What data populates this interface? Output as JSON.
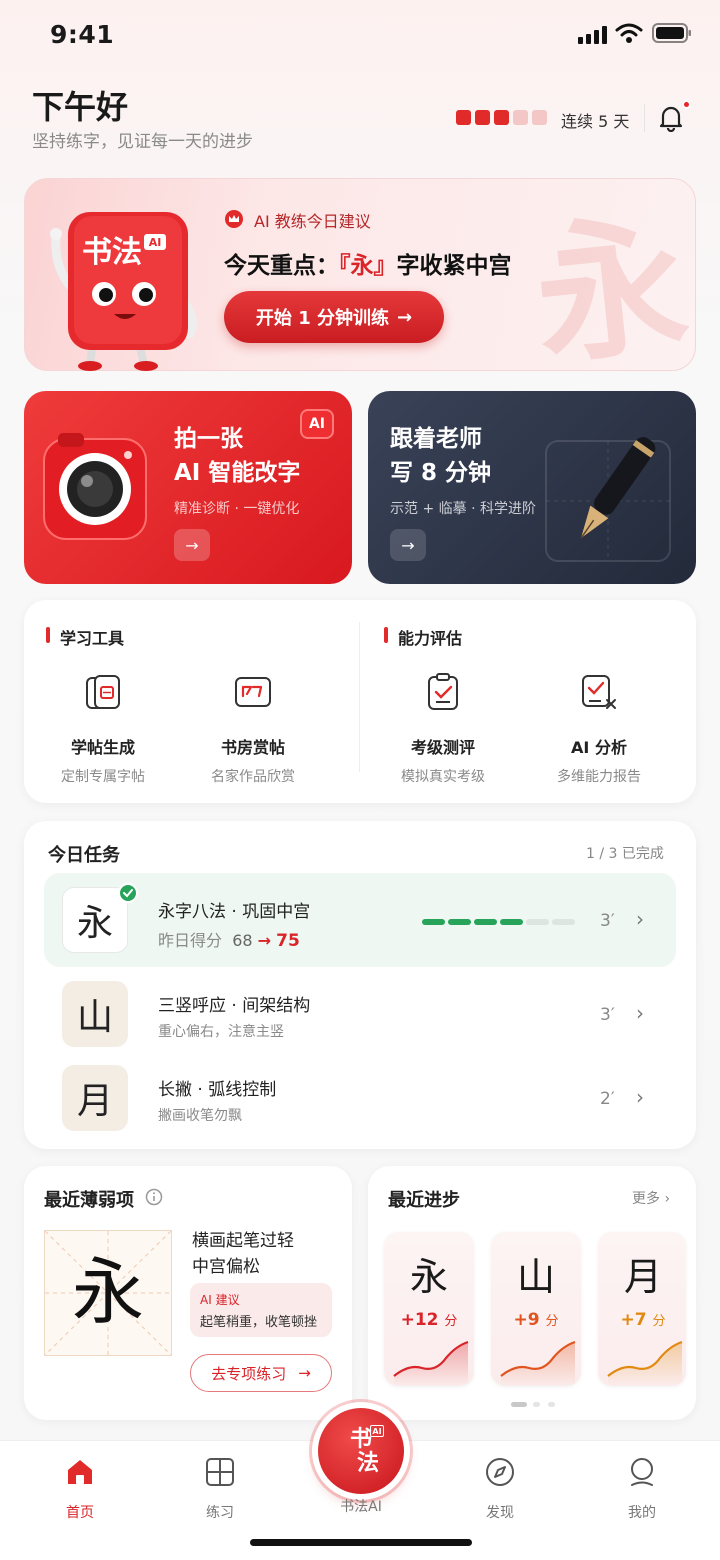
{
  "status": {
    "time": "9:41"
  },
  "header": {
    "greeting": "下午好",
    "subtitle": "坚持练字，见证每一天的进步",
    "streak_text": "连续 5 天",
    "streak_filled": 3,
    "streak_total": 5
  },
  "hero": {
    "tag": "AI 教练今日建议",
    "title_prefix": "今天重点：",
    "title_highlight": "『永』",
    "title_suffix": "字收紧中宫",
    "button": "开始 1 分钟训练",
    "bg_char": "永",
    "mascot_text": "书法",
    "mascot_badge": "AI"
  },
  "features": [
    {
      "title1": "拍一张",
      "title2": "AI 智能改字",
      "subtitle": "精准诊断 · 一键优化",
      "badge": "AI"
    },
    {
      "title1": "跟着老师",
      "title2": "写 8 分钟",
      "subtitle": "示范 + 临摹 · 科学进阶"
    }
  ],
  "tools": {
    "left_title": "学习工具",
    "right_title": "能力评估",
    "items": [
      {
        "name": "学帖生成",
        "desc": "定制专属字帖",
        "icon": "copybook-icon"
      },
      {
        "name": "书房赏帖",
        "desc": "名家作品欣赏",
        "icon": "gallery-icon"
      },
      {
        "name": "考级测评",
        "desc": "模拟真实考级",
        "icon": "exam-icon"
      },
      {
        "name": "AI 分析",
        "desc": "多维能力报告",
        "icon": "analysis-icon"
      }
    ]
  },
  "tasks": {
    "title": "今日任务",
    "progress": "1 / 3 已完成",
    "items": [
      {
        "char": "永",
        "name": "永字八法 · 巩固中宫",
        "desc_prefix": "昨日得分",
        "score_from": "68",
        "arrow": "→",
        "score_to": "75",
        "minutes": "3′",
        "done": true,
        "segments_done": 4,
        "segments_total": 6
      },
      {
        "char": "山",
        "name": "三竖呼应 · 间架结构",
        "desc": "重心偏右，注意主竖",
        "minutes": "3′",
        "done": false
      },
      {
        "char": "月",
        "name": "长撇 · 弧线控制",
        "desc": "撇画收笔勿飘",
        "minutes": "2′",
        "done": false
      }
    ]
  },
  "weak": {
    "title": "最近薄弱项",
    "char": "永",
    "line1": "横画起笔过轻",
    "line2": "中宫偏松",
    "ai_tag": "AI 建议",
    "ai_text": "起笔稍重，收笔顿挫",
    "button": "去专项练习"
  },
  "progress": {
    "title": "最近进步",
    "more": "更多",
    "items": [
      {
        "char": "永",
        "delta": "+12",
        "unit": "分",
        "color": "#d9242a"
      },
      {
        "char": "山",
        "delta": "+9",
        "unit": "分",
        "color": "#e0541f"
      },
      {
        "char": "月",
        "delta": "+7",
        "unit": "分",
        "color": "#e08a12"
      }
    ]
  },
  "tabbar": {
    "items": [
      "首页",
      "练习",
      "书法AI",
      "发现",
      "我的"
    ],
    "active": "首页",
    "center_text1": "书",
    "center_text2": "法",
    "center_badge": "AI"
  }
}
